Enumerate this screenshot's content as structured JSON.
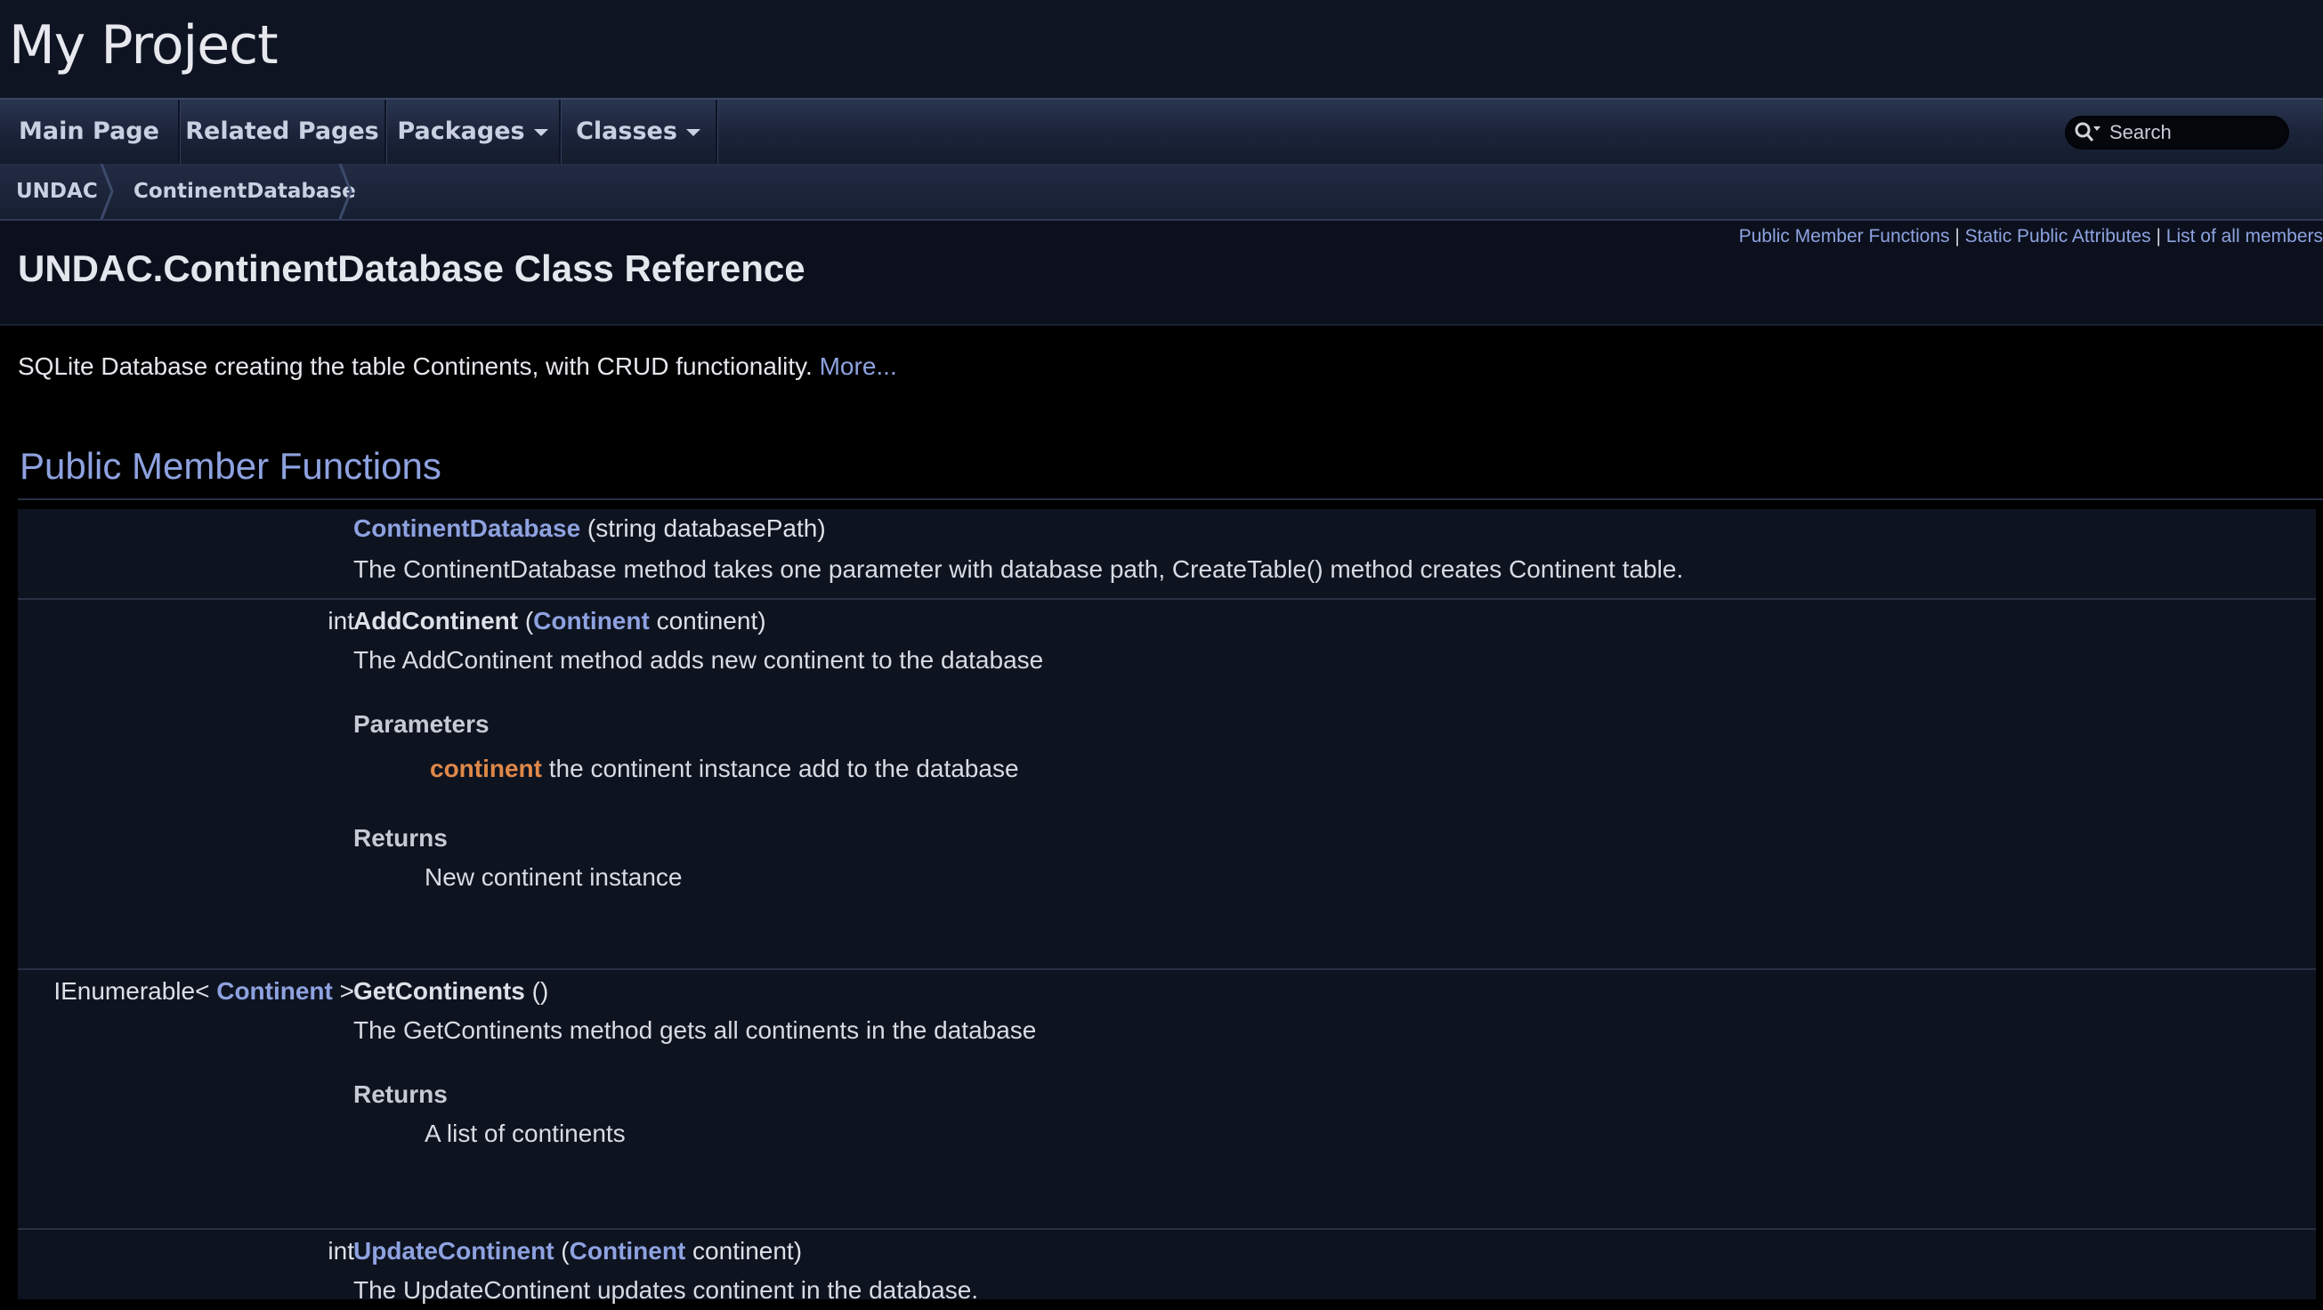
{
  "project": {
    "name": "My Project"
  },
  "nav": {
    "items": [
      {
        "label": "Main Page"
      },
      {
        "label": "Related Pages"
      },
      {
        "label": "Packages"
      },
      {
        "label": "Classes"
      }
    ],
    "search_placeholder": "Search",
    "search_icon": "magnifier-icon"
  },
  "breadcrumb": [
    {
      "label": "UNDAC"
    },
    {
      "label": "ContinentDatabase"
    }
  ],
  "summary": {
    "links": [
      "Public Member Functions",
      "Static Public Attributes",
      "List of all members"
    ],
    "separator": "|"
  },
  "title": "UNDAC.ContinentDatabase Class Reference",
  "brief": {
    "text": "SQLite Database creating the table Continents, with CRUD functionality.",
    "more": "More..."
  },
  "section": {
    "title": "Public Member Functions"
  },
  "members": [
    {
      "type_prefix": "",
      "type_link": "",
      "type_suffix": "",
      "name": "ContinentDatabase",
      "args_prefix": " (string databasePath)",
      "args_link": "",
      "args_suffix": "",
      "desc": "The ContinentDatabase method takes one parameter with database path, CreateTable() method creates Continent table."
    },
    {
      "type_prefix": "int",
      "name": "AddContinent",
      "args_prefix": " (",
      "args_link": "Continent",
      "args_suffix": " continent)",
      "desc": "The AddContinent method adds new continent to the database",
      "params_label": "Parameters",
      "param_name": "continent",
      "param_text": " the continent instance add to the database",
      "returns_label": "Returns",
      "returns_text": "New continent instance"
    },
    {
      "type_prefix": "IEnumerable< ",
      "type_link": "Continent",
      "type_suffix": " >",
      "name": "GetContinents",
      "args_prefix": " ()",
      "desc": "The GetContinents method gets all continents in the database",
      "returns_label": "Returns",
      "returns_text": "A list of continents"
    },
    {
      "type_prefix": "int",
      "name": "UpdateContinent",
      "args_prefix": " (",
      "args_link": "Continent",
      "args_suffix": " continent)",
      "desc": "The UpdateContinent updates continent in the database."
    }
  ]
}
